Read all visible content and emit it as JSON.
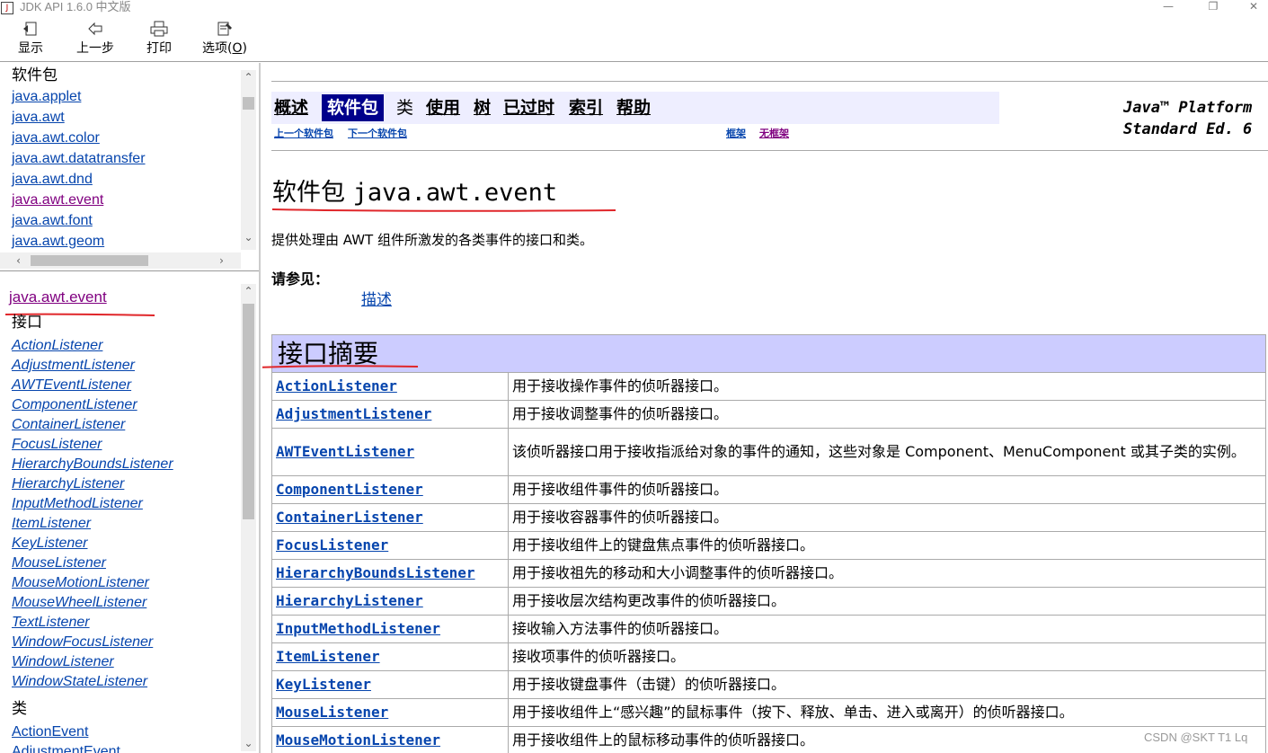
{
  "window": {
    "title": "JDK API 1.6.0 中文版",
    "minimize": "—",
    "maximize": "❐",
    "close": "✕"
  },
  "toolbar": {
    "show_label": "显示",
    "back_label": "上一步",
    "print_label": "打印",
    "options_label": "选项(",
    "options_accel": "O",
    "options_tail": ")"
  },
  "left": {
    "packages_heading": "软件包",
    "packages": [
      "java.applet",
      "java.awt",
      "java.awt.color",
      "java.awt.datatransfer",
      "java.awt.dnd",
      "java.awt.event",
      "java.awt.font",
      "java.awt.geom"
    ],
    "current_package": "java.awt.event",
    "interfaces_heading": "接口",
    "interfaces": [
      "ActionListener",
      "AdjustmentListener",
      "AWTEventListener",
      "ComponentListener",
      "ContainerListener",
      "FocusListener",
      "HierarchyBoundsListener",
      "HierarchyListener",
      "InputMethodListener",
      "ItemListener",
      "KeyListener",
      "MouseListener",
      "MouseMotionListener",
      "MouseWheelListener",
      "TextListener",
      "WindowFocusListener",
      "WindowListener",
      "WindowStateListener"
    ],
    "classes_heading": "类",
    "classes": [
      "ActionEvent",
      "AdjustmentEvent"
    ]
  },
  "nav": {
    "overview": "概述",
    "package": "软件包",
    "class": "类",
    "use": "使用",
    "tree": "树",
    "deprecated": "已过时",
    "index": "索引",
    "help": "帮助",
    "prev_package": "上一个软件包",
    "next_package": "下一个软件包",
    "frames": "框架",
    "no_frames": "无框架",
    "platform_line1": "Java™ Platform",
    "platform_line2": "Standard Ed. 6"
  },
  "main": {
    "title_prefix": "软件包",
    "title_name": "java.awt.event",
    "description": "提供处理由 AWT 组件所激发的各类事件的接口和类。",
    "see_also_label": "请参见：",
    "see_also_link": "描述",
    "summary_heading": "接口摘要",
    "rows": [
      {
        "name": "ActionListener",
        "desc": "用于接收操作事件的侦听器接口。"
      },
      {
        "name": "AdjustmentListener",
        "desc": "用于接收调整事件的侦听器接口。"
      },
      {
        "name": "AWTEventListener",
        "desc": "该侦听器接口用于接收指派给对象的事件的通知，这些对象是 Component、MenuComponent 或其子类的实例。"
      },
      {
        "name": "ComponentListener",
        "desc": "用于接收组件事件的侦听器接口。"
      },
      {
        "name": "ContainerListener",
        "desc": "用于接收容器事件的侦听器接口。"
      },
      {
        "name": "FocusListener",
        "desc": "用于接收组件上的键盘焦点事件的侦听器接口。"
      },
      {
        "name": "HierarchyBoundsListener",
        "desc": "用于接收祖先的移动和大小调整事件的侦听器接口。"
      },
      {
        "name": "HierarchyListener",
        "desc": "用于接收层次结构更改事件的侦听器接口。"
      },
      {
        "name": "InputMethodListener",
        "desc": "接收输入方法事件的侦听器接口。"
      },
      {
        "name": "ItemListener",
        "desc": "接收项事件的侦听器接口。"
      },
      {
        "name": "KeyListener",
        "desc": "用于接收键盘事件（击键）的侦听器接口。"
      },
      {
        "name": "MouseListener",
        "desc": "用于接收组件上“感兴趣”的鼠标事件（按下、释放、单击、进入或离开）的侦听器接口。"
      },
      {
        "name": "MouseMotionListener",
        "desc": "用于接收组件上的鼠标移动事件的侦听器接口。"
      }
    ]
  },
  "watermark": "CSDN @SKT T1 Lq",
  "colors": {
    "link": "#0645ad",
    "visited": "#800080",
    "nav_bg": "#eeeeff",
    "nav_current_bg": "#00008b",
    "table_header_bg": "#ccccff",
    "annotation_red": "#e0262a"
  }
}
